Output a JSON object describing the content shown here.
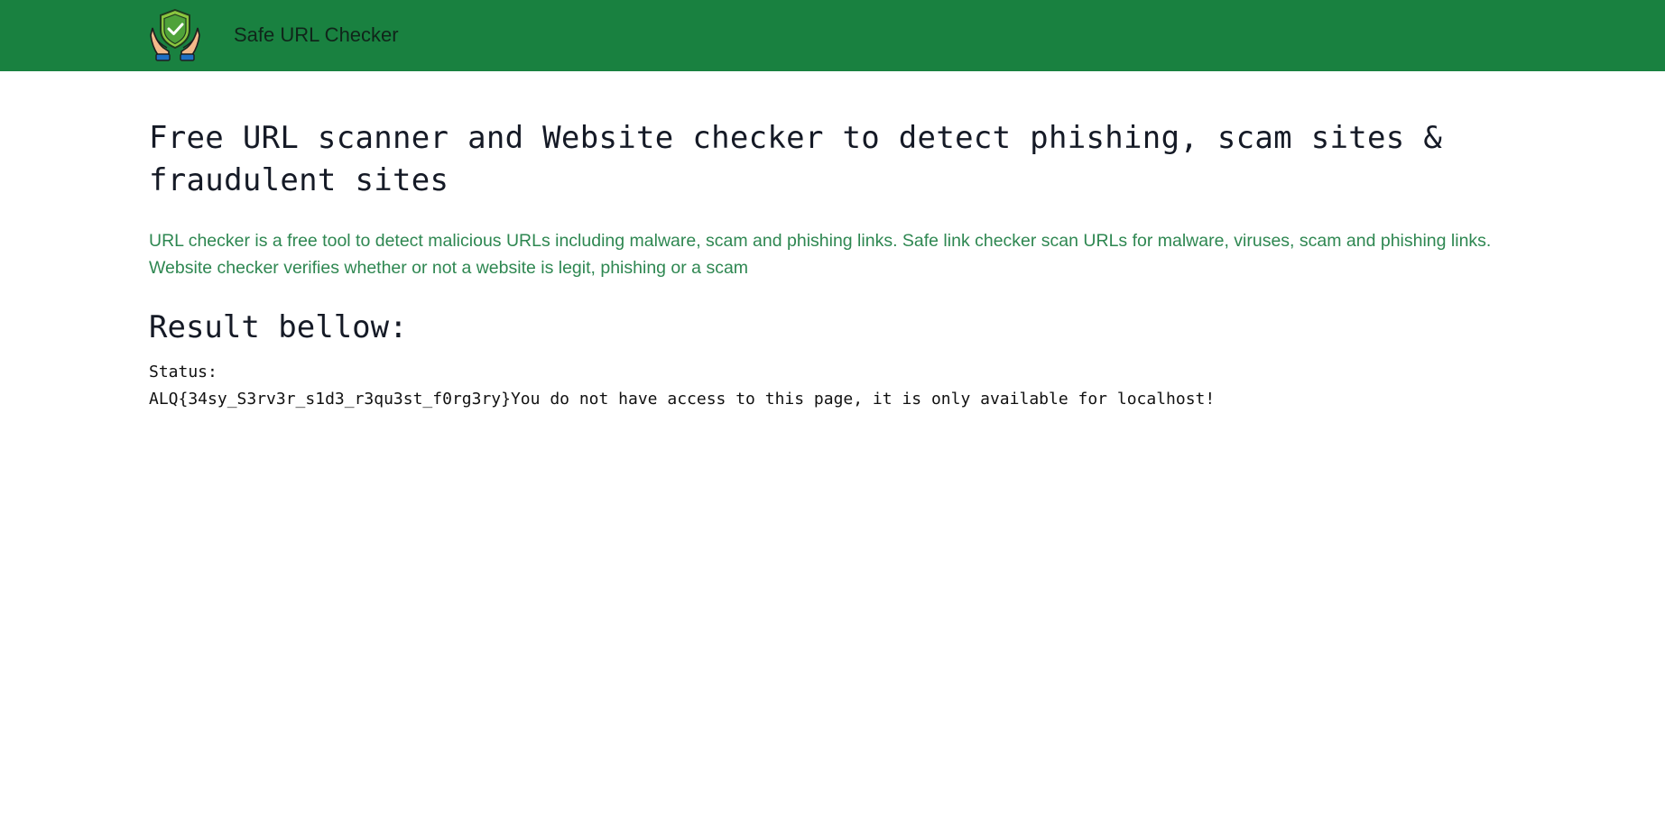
{
  "header": {
    "brand_name": "Safe URL Checker",
    "logo_icon": "shield-hands-icon",
    "background_color": "#198140"
  },
  "main": {
    "title": "Free URL scanner and Website checker to detect phishing, scam sites & fraudulent sites",
    "description": "URL checker is a free tool to detect malicious URLs including malware, scam and phishing links. Safe link checker scan URLs for malware, viruses, scam and phishing links. Website checker verifies whether or not a website is legit, phishing or a scam",
    "result_heading": "Result bellow:",
    "status_label": "Status:",
    "status_value": "ALQ{34sy_S3rv3r_s1d3_r3qu3st_f0rg3ry}You do not have access to this page, it is only available for localhost!"
  },
  "colors": {
    "accent_text": "#2e8751",
    "heading_text": "#151a26"
  }
}
